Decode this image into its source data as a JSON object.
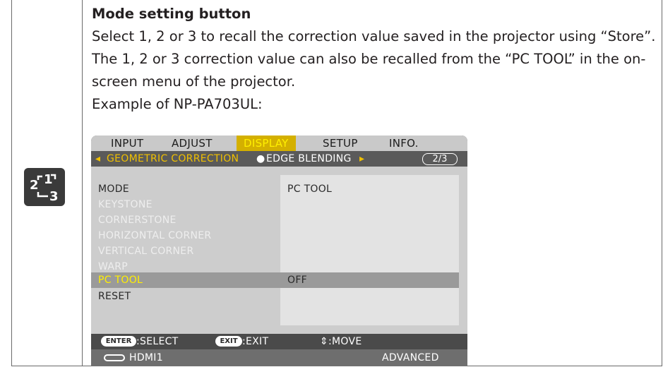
{
  "icon": {
    "name": "mode-setting-icon",
    "chars": [
      "2",
      "1",
      "3"
    ]
  },
  "text": {
    "heading": "Mode setting button",
    "line1": "Select 1, 2 or 3 to recall the correction value saved in the projector using “Store”.",
    "line2": "The 1, 2 or 3 correction value can also be recalled from the “PC TOOL” in the on-",
    "line3": "screen menu of the projector.",
    "line4": "Example of NP-PA703UL:"
  },
  "osd": {
    "tabs": [
      "INPUT",
      "ADJUST",
      "DISPLAY",
      "SETUP",
      "INFO."
    ],
    "active_tab": "DISPLAY",
    "subbar": {
      "left_arrow": "◂",
      "active": "GEOMETRIC CORRECTION",
      "bullet": "●",
      "other": "EDGE BLENDING",
      "right_arrow": "▸",
      "page": "2/3"
    },
    "items": [
      {
        "label": "MODE",
        "state": "normal"
      },
      {
        "label": "KEYSTONE",
        "state": "disabled"
      },
      {
        "label": "CORNERSTONE",
        "state": "disabled"
      },
      {
        "label": "HORIZONTAL CORNER",
        "state": "disabled"
      },
      {
        "label": "VERTICAL CORNER",
        "state": "disabled"
      },
      {
        "label": "WARP",
        "state": "disabled"
      },
      {
        "label": "PC TOOL",
        "state": "selected"
      },
      {
        "label": "RESET",
        "state": "normal"
      }
    ],
    "values": {
      "mode": "PC TOOL",
      "pc_tool": "OFF"
    },
    "footer": {
      "enter_key": "ENTER",
      "enter_label": ":SELECT",
      "exit_key": "EXIT",
      "exit_label": ":EXIT",
      "move_label": "⇕:MOVE"
    },
    "status": {
      "input": "HDMI1",
      "mode": "ADVANCED"
    }
  },
  "colors": {
    "highlight_yellow": "#ffef00",
    "active_tab_bg": "#d4b000",
    "osd_dark": "#4a4a4a"
  }
}
